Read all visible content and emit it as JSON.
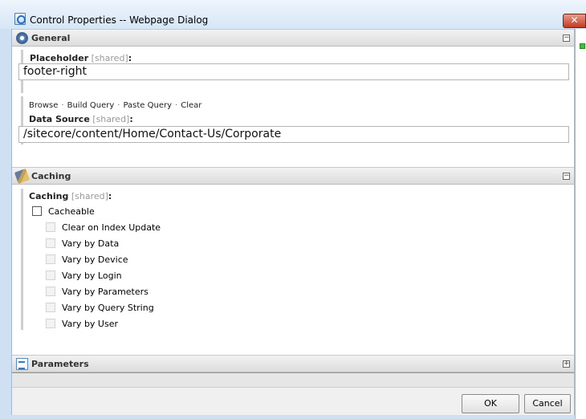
{
  "window": {
    "title": "Control Properties -- Webpage Dialog",
    "close_label": "✕"
  },
  "sections": {
    "general": {
      "title": "General",
      "toggle": "−"
    },
    "caching": {
      "title": "Caching",
      "toggle": "−"
    },
    "parameters": {
      "title": "Parameters",
      "toggle": "+"
    }
  },
  "placeholder": {
    "label": "Placeholder",
    "shared": "[shared]",
    "colon": ":",
    "value": "footer-right"
  },
  "datasource": {
    "links": [
      "Browse",
      "Build Query",
      "Paste Query",
      "Clear"
    ],
    "separator": "·",
    "label": "Data Source",
    "shared": "[shared]",
    "colon": ":",
    "value": "/sitecore/content/Home/Contact-Us/Corporate"
  },
  "caching": {
    "label": "Caching",
    "shared": "[shared]",
    "colon": ":",
    "cacheable": "Cacheable",
    "options": [
      "Clear on Index Update",
      "Vary by Data",
      "Vary by Device",
      "Vary by Login",
      "Vary by Parameters",
      "Vary by Query String",
      "Vary by User"
    ]
  },
  "buttons": {
    "ok": "OK",
    "cancel": "Cancel"
  }
}
